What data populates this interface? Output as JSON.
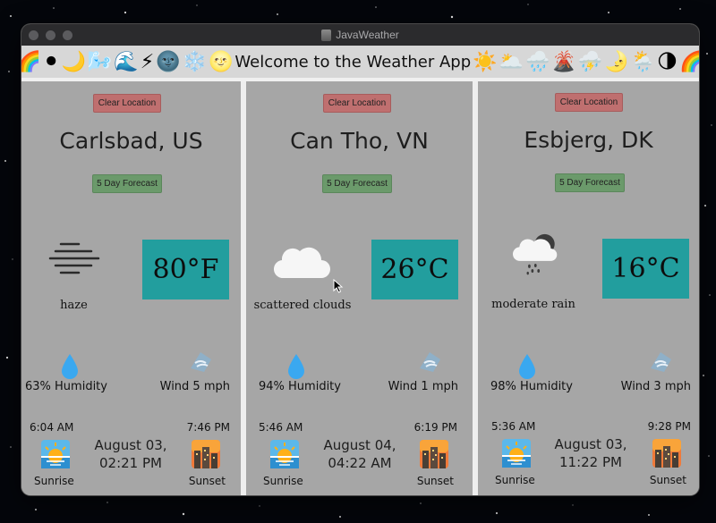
{
  "window": {
    "title": "JavaWeather"
  },
  "banner": {
    "welcome": "Welcome to the Weather App",
    "emoji_left": [
      "🌈",
      "⚫",
      "🌙",
      "🌬️",
      "🌊",
      "⚡",
      "🌚",
      "❄️",
      "🌝"
    ],
    "emoji_right": [
      "☀️",
      "🌥️",
      "🌧️",
      "🌋",
      "⛈️",
      "🌛",
      "🌦️",
      "🌗",
      "🌈"
    ]
  },
  "panels": [
    {
      "clear_label": "Clear Location",
      "city": "Carlsbad, US",
      "forecast_label": "5 Day Forecast",
      "icon": "haze-icon",
      "description": "haze",
      "temperature": "80°F",
      "humidity": "63% Humidity",
      "wind": "Wind 5 mph",
      "sunrise_time": "6:04 AM",
      "sunset_time": "7:46 PM",
      "sunrise_label": "Sunrise",
      "sunset_label": "Sunset",
      "date_line1": "August 03,",
      "date_line2": "02:21 PM"
    },
    {
      "clear_label": "Clear Location",
      "city": "Can Tho, VN",
      "forecast_label": "5 Day Forecast",
      "icon": "cloud-icon",
      "description": "scattered clouds",
      "temperature": "26°C",
      "humidity": "94% Humidity",
      "wind": "Wind 1 mph",
      "sunrise_time": "5:46 AM",
      "sunset_time": "6:19 PM",
      "sunrise_label": "Sunrise",
      "sunset_label": "Sunset",
      "date_line1": "August 04,",
      "date_line2": "04:22 AM"
    },
    {
      "clear_label": "Clear Location",
      "city": "Esbjerg, DK",
      "forecast_label": "5 Day Forecast",
      "icon": "moon-rain-cloud-icon",
      "description": "moderate rain",
      "temperature": "16°C",
      "humidity": "98% Humidity",
      "wind": "Wind 3 mph",
      "sunrise_time": "5:36 AM",
      "sunset_time": "9:28 PM",
      "sunrise_label": "Sunrise",
      "sunset_label": "Sunset",
      "date_line1": "August 03,",
      "date_line2": "11:22 PM"
    }
  ],
  "colors": {
    "temp_box": "#229e9e",
    "clear_button": "#bf6f6f",
    "forecast_button": "#6b9a6b",
    "panel_bg": "#a6a6a6"
  }
}
